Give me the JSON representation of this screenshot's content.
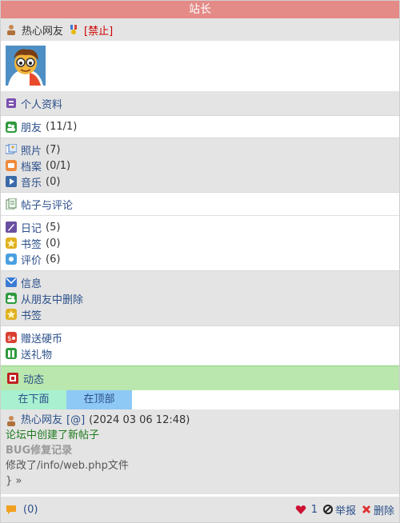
{
  "header": {
    "title": "站长"
  },
  "user": {
    "name": "热心网友",
    "ban_label": "[禁止]"
  },
  "menu": {
    "profile": "个人资料",
    "friends": {
      "label": "朋友",
      "count": "(11/1)"
    },
    "photos": {
      "label": "照片",
      "count": "(7)"
    },
    "files": {
      "label": "档案",
      "count": "(0/1)"
    },
    "music": {
      "label": "音乐",
      "count": "(0)"
    },
    "posts_comments": "帖子与评论",
    "diary": {
      "label": "日记",
      "count": "(5)"
    },
    "bookmarks": {
      "label": "书签",
      "count": "(0)"
    },
    "reviews": {
      "label": "评价",
      "count": "(6)"
    },
    "message": "信息",
    "remove_friend": "从朋友中删除",
    "bookmark": "书签",
    "send_coins": "赠送硬币",
    "send_gift": "送礼物"
  },
  "activity": {
    "title": "动态",
    "tabs": [
      "在下面",
      "在顶部"
    ]
  },
  "post": {
    "author": "热心网友",
    "mention": "[@]",
    "timestamp": "(2024 03 06 12:48)",
    "action": "论坛中创建了新帖子",
    "title": "BUG修复记录",
    "body": "修改了/info/web.php文件",
    "tail": "} »"
  },
  "footer": {
    "comments": "(0)",
    "likes": "1",
    "report": "举报",
    "delete": "删除"
  },
  "colors": {
    "header_bg": "#e48a87",
    "link": "#2b4f8a",
    "ban": "#d00000",
    "activity_bg": "#b9e7ad"
  }
}
